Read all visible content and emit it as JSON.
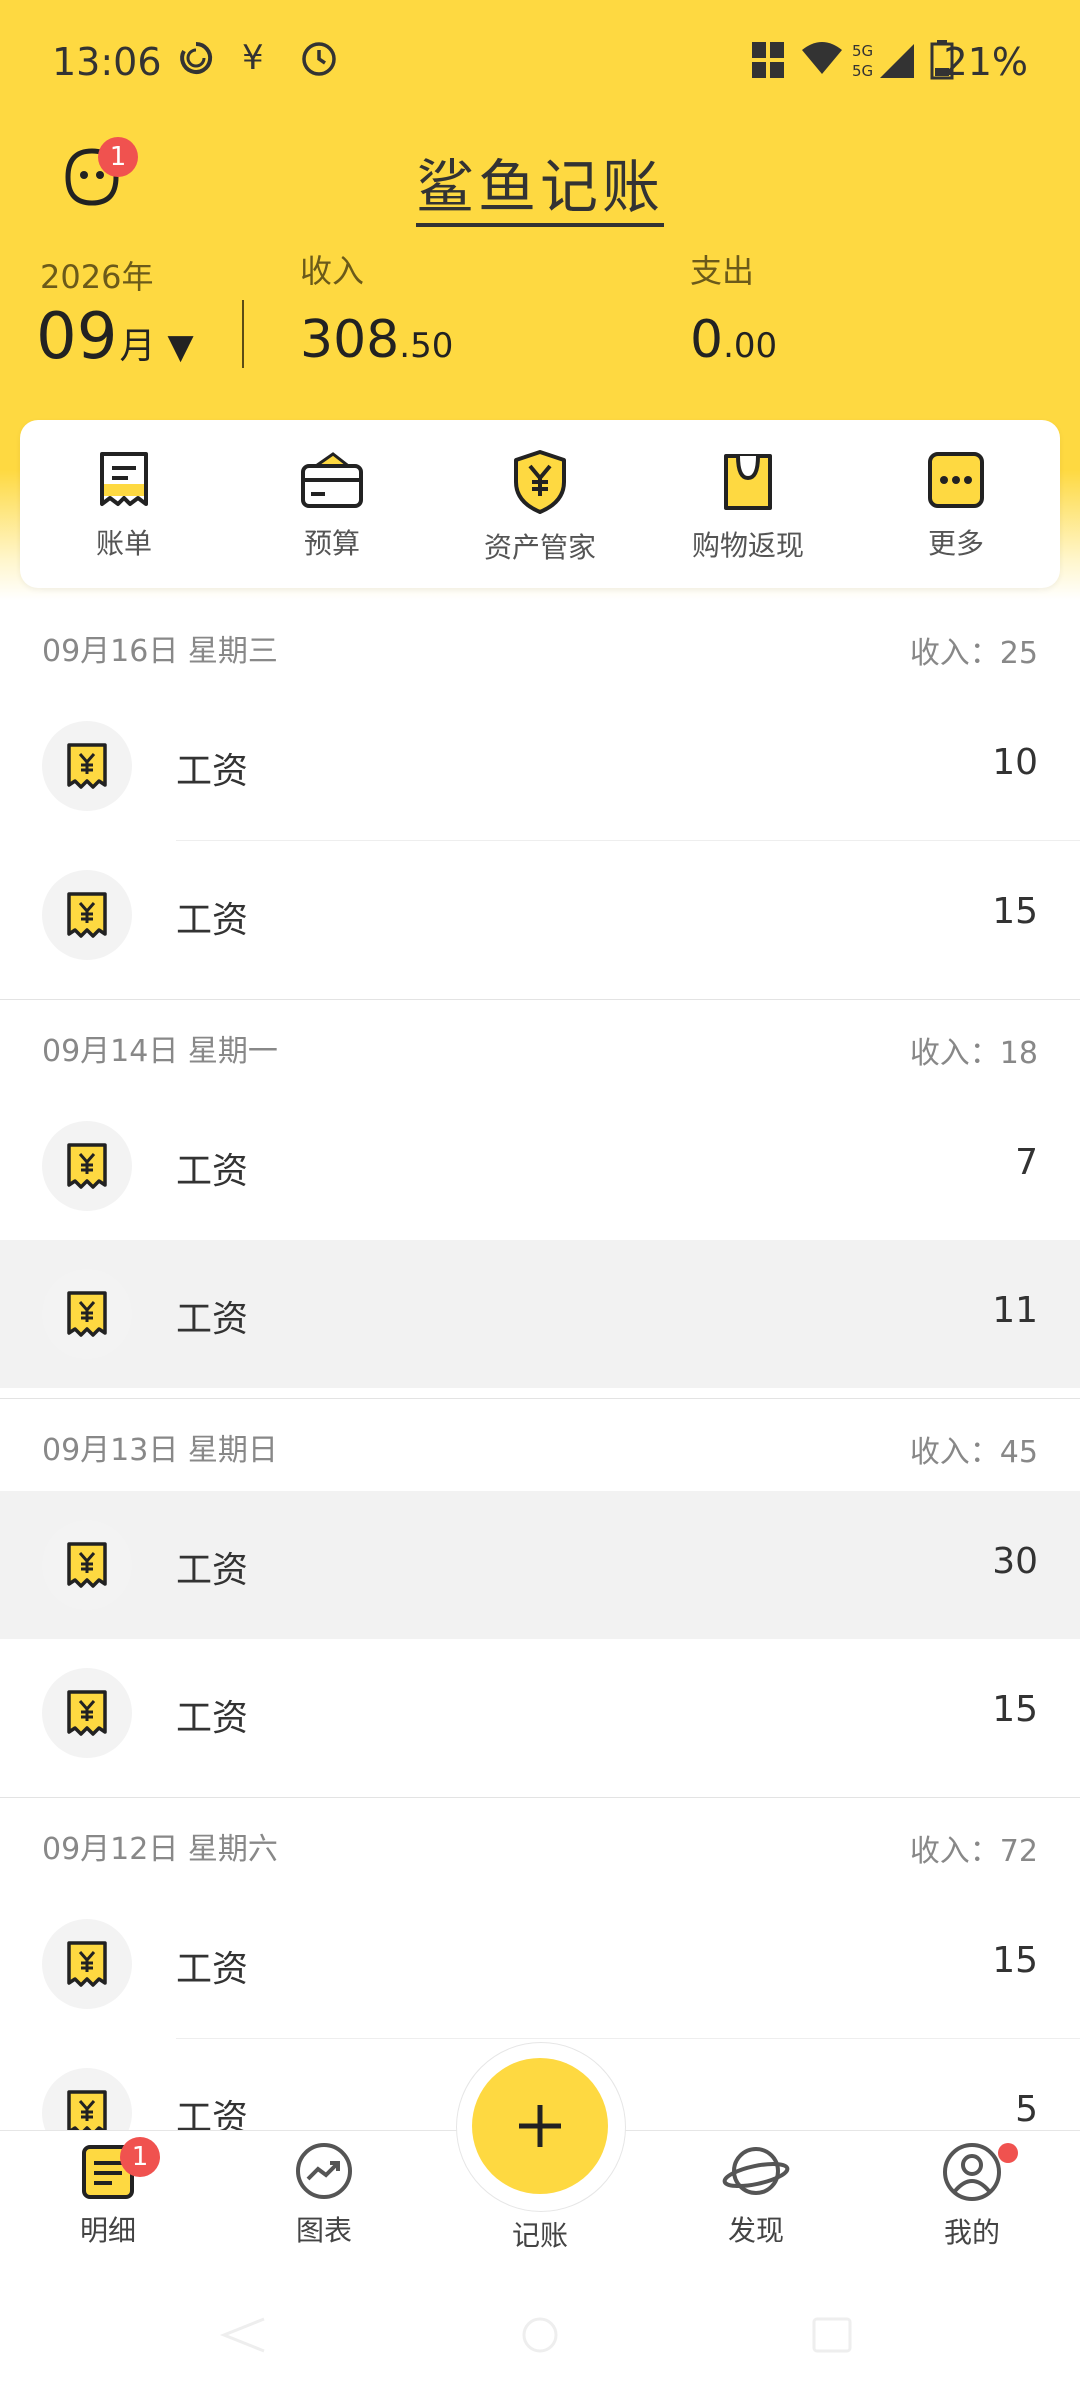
{
  "status_bar": {
    "time": "13:06",
    "battery_text": "21%",
    "network": "5G"
  },
  "header": {
    "title": "鲨鱼记账",
    "avatar_badge": "1",
    "year": "2026年",
    "month_num": "09",
    "month_unit": "月",
    "income_label": "收入",
    "income_int": "308",
    "income_dec": ".50",
    "expense_label": "支出",
    "expense_int": "0",
    "expense_dec": ".00"
  },
  "quick_actions": [
    {
      "label": "账单",
      "icon": "bill-icon"
    },
    {
      "label": "预算",
      "icon": "wallet-icon"
    },
    {
      "label": "资产管家",
      "icon": "shield-yuan-icon"
    },
    {
      "label": "购物返现",
      "icon": "shopping-bag-icon"
    },
    {
      "label": "更多",
      "icon": "more-icon"
    }
  ],
  "days": [
    {
      "date": "09月16日 星期三",
      "income": "收入：25",
      "items": [
        {
          "name": "工资",
          "amount": "10"
        },
        {
          "name": "工资",
          "amount": "15"
        }
      ]
    },
    {
      "date": "09月14日 星期一",
      "income": "收入：18",
      "items": [
        {
          "name": "工资",
          "amount": "7"
        },
        {
          "name": "工资",
          "amount": "11"
        }
      ]
    },
    {
      "date": "09月13日 星期日",
      "income": "收入：45",
      "items": [
        {
          "name": "工资",
          "amount": "30"
        },
        {
          "name": "工资",
          "amount": "15"
        }
      ]
    },
    {
      "date": "09月12日 星期六",
      "income": "收入：72",
      "items": [
        {
          "name": "工资",
          "amount": "15"
        },
        {
          "name": "工资",
          "amount": "5"
        }
      ]
    }
  ],
  "bottom_nav": {
    "detail": "明细",
    "detail_badge": "1",
    "chart": "图表",
    "record": "记账",
    "discover": "发现",
    "mine": "我的"
  },
  "colors": {
    "accent": "#FED941",
    "badge": "#F0524F"
  }
}
